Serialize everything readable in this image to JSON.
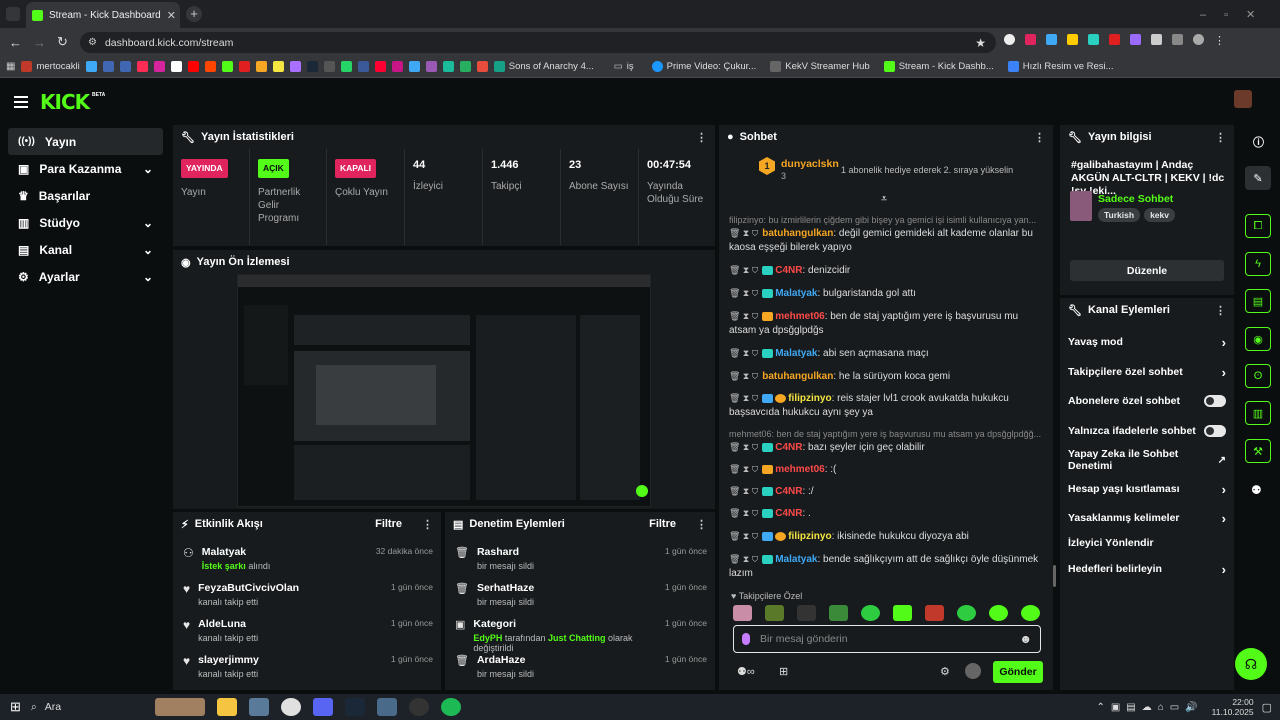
{
  "browser": {
    "tab_title": "Stream - Kick Dashboard",
    "url": "dashboard.kick.com/stream",
    "bookmarks": [
      "mertocakli",
      "Sons of Anarchy 4...",
      "iş",
      "Prime Video: Çukur...",
      "KekV Streamer Hub",
      "Stream - Kick Dashb...",
      "Hızlı Resim ve Resi..."
    ]
  },
  "app": {
    "logo": "KICK",
    "logo_sup": "BETA",
    "colors": {
      "accent": "#53fc18",
      "bg": "#0b0e0f",
      "panel": "#181b1d",
      "live_red": "#e0245e"
    },
    "nav": [
      {
        "label": "Yayın",
        "icon": "broadcast-icon",
        "chevron": false
      },
      {
        "label": "Para Kazanma",
        "icon": "money-icon",
        "chevron": true
      },
      {
        "label": "Başarılar",
        "icon": "trophy-icon",
        "chevron": false
      },
      {
        "label": "Stüdyo",
        "icon": "studio-icon",
        "chevron": true
      },
      {
        "label": "Kanal",
        "icon": "channel-icon",
        "chevron": true
      },
      {
        "label": "Ayarlar",
        "icon": "settings-icon",
        "chevron": true
      }
    ],
    "stats": {
      "title": "Yayın İstatistikleri",
      "items": [
        {
          "badge": "YAYINDA",
          "label": "Yayın"
        },
        {
          "badge": "AÇIK",
          "label": "Partnerlik Gelir Programı"
        },
        {
          "badge": "KAPALI",
          "label": "Çoklu Yayın"
        },
        {
          "value": "44",
          "label": "İzleyici"
        },
        {
          "value": "1.446",
          "label": "Takipçi"
        },
        {
          "value": "23",
          "label": "Abone Sayısı"
        },
        {
          "value": "00:47:54",
          "label": "Yayında Olduğu Süre"
        }
      ]
    },
    "preview": {
      "title": "Yayın Ön İzlemesi"
    },
    "activity": {
      "title": "Etkinlik Akışı",
      "filter": "Filtre",
      "items": [
        {
          "name": "Malatyak",
          "sub": "İstek şarkı",
          "sub_rest": " alındı",
          "time": "32 dakika önce"
        },
        {
          "name": "FeyzaButCivcivOlan",
          "sub": "kanalı takip etti",
          "time": "1 gün önce"
        },
        {
          "name": "AldeLuna",
          "sub": "kanalı takip etti",
          "time": "1 gün önce"
        },
        {
          "name": "slayerjimmy",
          "sub": "kanalı takip etti",
          "time": "1 gün önce"
        }
      ]
    },
    "moderation": {
      "title": "Denetim Eylemleri",
      "filter": "Filtre",
      "items": [
        {
          "name": "Rashard",
          "sub": "bir mesajı sildi",
          "time": "1 gün önce",
          "icon": "trash-icon"
        },
        {
          "name": "SerhatHaze",
          "sub": "bir mesajı sildi",
          "time": "1 gün önce",
          "icon": "trash-icon"
        },
        {
          "name": "Kategori",
          "sub_user": "EdyPH",
          "sub_mid": " tarafından ",
          "sub_cat": "Just Chatting",
          "sub_end": " olarak değiştirildi",
          "time": "1 gün önce",
          "icon": "category-icon"
        },
        {
          "name": "ArdaHaze",
          "sub": "bir mesajı sildi",
          "time": "1 gün önce",
          "icon": "trash-icon"
        }
      ]
    },
    "chat": {
      "title": "Sohbet",
      "pinned_user": "dunyaclskn",
      "pinned_count": "3",
      "pinned_msg": "1 abonelik hediye ederek 2. sıraya yükselin",
      "reply_hint_1": "filipzinyo: bu izmirlilerin çiğdem gibi bişey ya gemici işi isimli kullanıcıya yan...",
      "reply_hint_2": "mehmet06: ben de staj yaptığım yere iş başvurusu mu atsam ya dpsğglpdğğ...",
      "messages": [
        {
          "user": "batuhangulkan",
          "color": "#f5a623",
          "text": "değil gemici gemideki alt kademe olanlar bu kaosa eşşeği bilerek yapıyo"
        },
        {
          "user": "C4NR",
          "color": "#ff4a4a",
          "text": "denizcidir"
        },
        {
          "user": "Malatyak",
          "color": "#3fa9f5",
          "text": "bulgaristanda gol attı"
        },
        {
          "user": "mehmet06",
          "color": "#ff4a4a",
          "text": "ben de staj yaptığım yere iş başvurusu mu atsam ya dpsğglpdğs"
        },
        {
          "user": "Malatyak",
          "color": "#3fa9f5",
          "text": "abi sen açmasana maçı"
        },
        {
          "user": "batuhangulkan",
          "color": "#f5a623",
          "text": "he la sürüyom koca gemi"
        },
        {
          "user": "filipzinyo",
          "color": "#f5e642",
          "text": "reis stajer lvl1 crook avukatda hukukcu başsavcıda hukukcu aynı şey ya"
        },
        {
          "user": "C4NR",
          "color": "#ff4a4a",
          "text": "bazı şeyler için geç olabilir"
        },
        {
          "user": "mehmet06",
          "color": "#ff4a4a",
          "text": ":("
        },
        {
          "user": "C4NR",
          "color": "#ff4a4a",
          "text": ":/"
        },
        {
          "user": "C4NR",
          "color": "#ff4a4a",
          "text": "."
        },
        {
          "user": "filipzinyo",
          "color": "#f5e642",
          "text": "ikisinede hukukcu diyozya abi"
        },
        {
          "user": "Malatyak",
          "color": "#3fa9f5",
          "text": "bende sağlıkçıyım att de sağlıkçı öyle düşünmek lazım"
        }
      ],
      "follower_only": "Takipçilere Özel",
      "input_placeholder": "Bir mesaj gönderin",
      "send": "Gönder"
    },
    "stream_info": {
      "title": "Yayın bilgisi",
      "stream_title": "#galibahastayım | Andaç AKGÜN ALT-CLTR | KEKV | !dc !sv !eki...",
      "category": "Sadece Sohbet",
      "tags": [
        "Turkish",
        "kekv"
      ],
      "edit": "Düzenle"
    },
    "channel_actions": {
      "title": "Kanal Eylemleri",
      "items": [
        {
          "label": "Yavaş mod",
          "type": "chevron"
        },
        {
          "label": "Takipçilere özel sohbet",
          "type": "chevron"
        },
        {
          "label": "Abonelere özel sohbet",
          "type": "toggle"
        },
        {
          "label": "Yalnızca ifadelerle sohbet",
          "type": "toggle"
        },
        {
          "label": "Yapay Zeka ile Sohbet Denetimi",
          "type": "external"
        },
        {
          "label": "Hesap yaşı kısıtlaması",
          "type": "chevron"
        },
        {
          "label": "Yasaklanmış kelimeler",
          "type": "chevron"
        },
        {
          "label": "İzleyici Yönlendir",
          "type": "none"
        },
        {
          "label": "Hedefleri belirleyin",
          "type": "chevron"
        }
      ]
    }
  },
  "taskbar": {
    "search": "Ara",
    "time": "22:00",
    "date": "11.10.2025"
  }
}
